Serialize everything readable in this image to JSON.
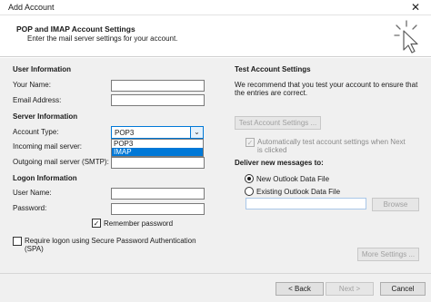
{
  "window": {
    "title": "Add Account",
    "close_glyph": "✕"
  },
  "header": {
    "title": "POP and IMAP Account Settings",
    "subtitle": "Enter the mail server settings for your account."
  },
  "user_info": {
    "heading": "User Information",
    "your_name_label": "Your Name:",
    "your_name_value": "",
    "email_label": "Email Address:",
    "email_value": ""
  },
  "server_info": {
    "heading": "Server Information",
    "account_type_label": "Account Type:",
    "account_type_value": "POP3",
    "account_type_options": [
      "POP3",
      "IMAP"
    ],
    "highlighted_option_index": 1,
    "incoming_label": "Incoming mail server:",
    "outgoing_label": "Outgoing mail server (SMTP):",
    "outgoing_value": ""
  },
  "logon_info": {
    "heading": "Logon Information",
    "user_name_label": "User Name:",
    "user_name_value": "",
    "password_label": "Password:",
    "password_value": "",
    "remember_password_label": "Remember password",
    "remember_password_checked": true,
    "spa_label_line1": "Require logon using Secure Password Authentication",
    "spa_label_line2": "(SPA)",
    "spa_checked": false
  },
  "test_settings": {
    "heading": "Test Account Settings",
    "description_line1": "We recommend that you test your account to ensure that",
    "description_line2": "the entries are correct.",
    "test_button": "Test Account Settings ...",
    "auto_test_label_line1": "Automatically test account settings when Next",
    "auto_test_label_line2": "is clicked",
    "auto_test_checked": true
  },
  "deliver": {
    "heading": "Deliver new messages to:",
    "new_file_label": "New Outlook Data File",
    "existing_file_label": "Existing Outlook Data File",
    "selected": "new",
    "existing_path_value": "",
    "browse_button": "Browse"
  },
  "more_settings_button": "More Settings ...",
  "footer": {
    "back_button": "< Back",
    "next_button": "Next >",
    "cancel_button": "Cancel"
  },
  "icons": {
    "check": "✓",
    "dropdown_arrow": "⌄"
  }
}
